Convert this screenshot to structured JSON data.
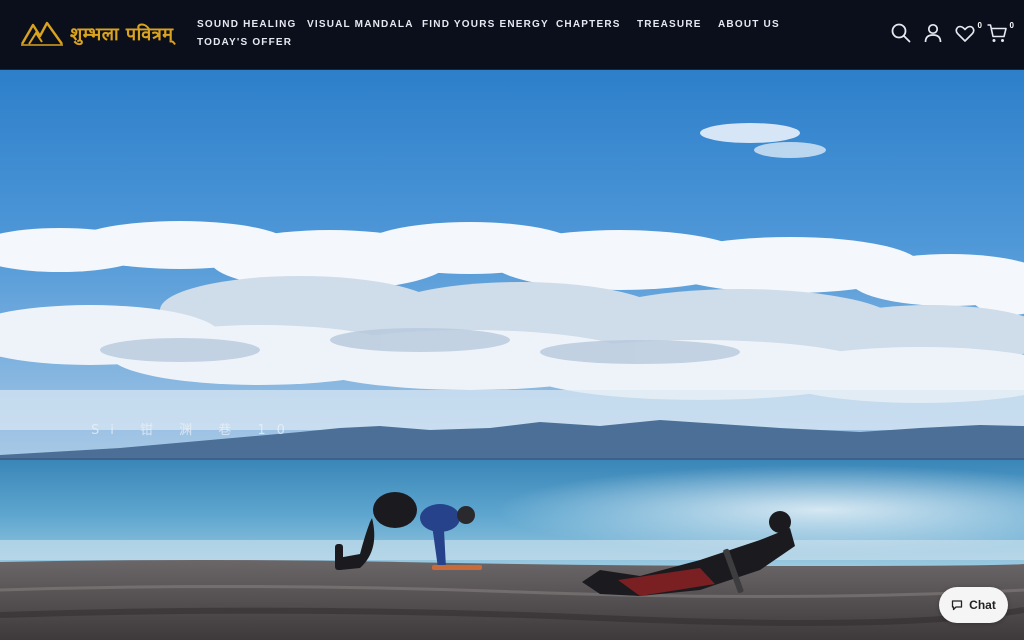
{
  "brand": {
    "name": "शुम्भला पवित्रम्"
  },
  "nav": {
    "items": [
      {
        "label": "SOUND HEALING"
      },
      {
        "label": "VISUAL MANDALA"
      },
      {
        "label": "FIND YOURS ENERGY"
      },
      {
        "label": "CHAPTERS"
      },
      {
        "label": "TREASURE"
      },
      {
        "label": "ABOUT US"
      },
      {
        "label": "TODAY'S OFFER"
      }
    ]
  },
  "header_icons": {
    "search": "search-icon",
    "account": "user-icon",
    "wishlist": {
      "icon": "heart-icon",
      "count": "0"
    },
    "cart": {
      "icon": "cart-icon",
      "count": "0"
    }
  },
  "hero": {
    "watermark": "Si 钳 渊 巷 10"
  },
  "chat": {
    "label": "Chat",
    "icon": "chat-bubble-icon"
  },
  "colors": {
    "header_bg": "#0b0f1c",
    "brand_gold": "#d9a21f",
    "nav_text": "#e6e9f0"
  }
}
